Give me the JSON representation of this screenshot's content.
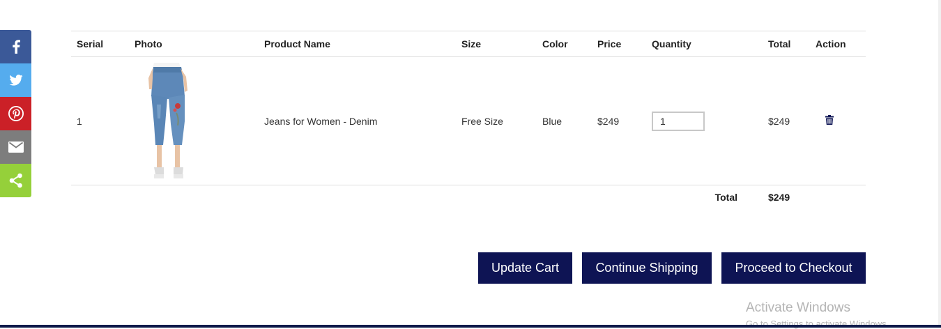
{
  "share": {
    "items": [
      {
        "name": "facebook",
        "color": "#3b5998",
        "icon": "facebook-icon"
      },
      {
        "name": "twitter",
        "color": "#55acee",
        "icon": "twitter-icon"
      },
      {
        "name": "pinterest",
        "color": "#cb2027",
        "icon": "pinterest-icon"
      },
      {
        "name": "email",
        "color": "#7d7d7d",
        "icon": "email-icon"
      },
      {
        "name": "share",
        "color": "#95d03a",
        "icon": "share-icon"
      }
    ]
  },
  "cart": {
    "headers": {
      "serial": "Serial",
      "photo": "Photo",
      "product_name": "Product Name",
      "size": "Size",
      "color": "Color",
      "price": "Price",
      "quantity": "Quantity",
      "total": "Total",
      "action": "Action"
    },
    "items": [
      {
        "serial": "1",
        "product_name": "Jeans for Women - Denim",
        "size": "Free Size",
        "color": "Blue",
        "price": "$249",
        "quantity": "1",
        "total": "$249",
        "action_icon": "trash-icon"
      }
    ],
    "summary": {
      "label": "Total",
      "value": "$249"
    }
  },
  "buttons": {
    "update": "Update Cart",
    "continue": "Continue Shipping",
    "checkout": "Proceed to Checkout"
  },
  "watermark": {
    "title": "Activate Windows",
    "subtitle": "Go to Settings to activate Windows."
  },
  "colors": {
    "button_bg": "#0e1454",
    "trash": "#0e1454"
  }
}
